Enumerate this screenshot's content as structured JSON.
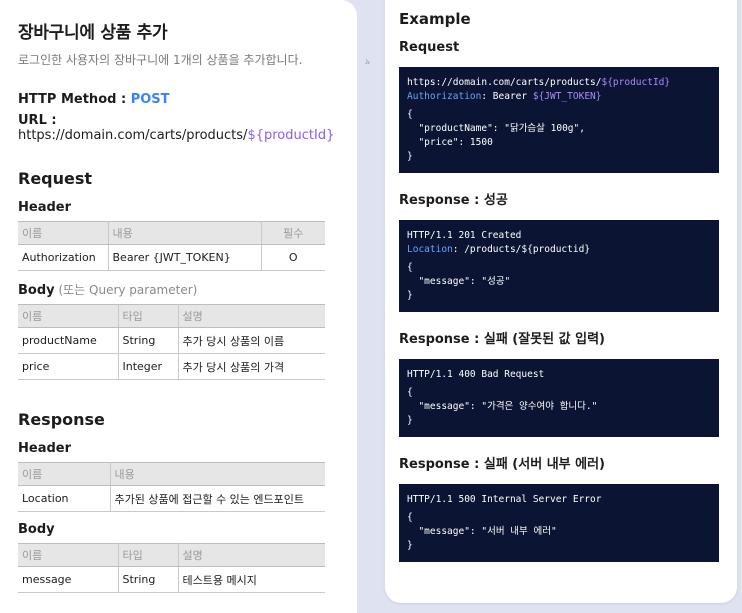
{
  "left": {
    "title": "장바구니에 상품 추가",
    "description": "로그인한 사용자의 장바구니에 1개의 상품을 추가합니다.",
    "http_method_label": "HTTP Method : ",
    "http_method": "POST",
    "url_label": "URL : ",
    "url_base": "https://domain.com/carts/products/",
    "url_var": "${productId}",
    "request": {
      "heading": "Request",
      "header_heading": "Header",
      "header_table": {
        "columns": [
          "이름",
          "내용",
          "필수"
        ],
        "rows": [
          [
            "Authorization",
            "Bearer {JWT_TOKEN}",
            "O"
          ]
        ]
      },
      "body_heading": "Body",
      "body_note": " (또는 Query parameter)",
      "body_table": {
        "columns": [
          "이름",
          "타입",
          "설명"
        ],
        "rows": [
          [
            "productName",
            "String",
            "추가 당시 상품의 이름"
          ],
          [
            "price",
            "Integer",
            "추가 당시 상품의 가격"
          ]
        ]
      }
    },
    "response": {
      "heading": "Response",
      "header_heading": "Header",
      "header_table": {
        "columns": [
          "이름",
          "내용"
        ],
        "rows": [
          [
            "Location",
            "추가된 상품에 접근할 수 있는 엔드포인트"
          ]
        ]
      },
      "body_heading": "Body",
      "body_table": {
        "columns": [
          "이름",
          "타입",
          "설명"
        ],
        "rows": [
          [
            "message",
            "String",
            "테스트용 메시지"
          ]
        ]
      }
    }
  },
  "gutter_mark": "৯",
  "right": {
    "title": "Example",
    "request_label": "Request",
    "request_code": {
      "url_base": "https://domain.com/carts/products/",
      "url_var": "${productId}",
      "auth_key": "Authorization",
      "auth_colon": ": Bearer ",
      "auth_var": "${JWT_TOKEN}",
      "body_open": "{",
      "line1": "  \"productName\": \"닭가슴살 100g\",",
      "line2": "  \"price\": 1500",
      "body_close": "}"
    },
    "success_label": "Response : 성공",
    "success_code": {
      "status": "HTTP/1.1 201 Created",
      "loc_key": "Location",
      "loc_val": ": /products/${productid}",
      "body_open": "{",
      "line1": "  \"message\": \"성공\"",
      "body_close": "}"
    },
    "fail1_label": "Response : 실패 (잘못된 값 입력)",
    "fail1_code": {
      "status": "HTTP/1.1 400 Bad Request",
      "body_open": "{",
      "line1": "  \"message\": \"가격은 양수여야 합니다.\"",
      "body_close": "}"
    },
    "fail2_label": "Response : 실패 (서버 내부 에러)",
    "fail2_code": {
      "status": "HTTP/1.1 500 Internal Server Error",
      "body_open": "{",
      "line1": "  \"message\": \"서버 내부 에러\"",
      "body_close": "}"
    }
  },
  "colors": {
    "accent_method": "#3b82f6",
    "variable": "#8b5cf6",
    "code_bg": "#0b1533",
    "code_key": "#60a5fa",
    "background": "#dfe2f0"
  }
}
